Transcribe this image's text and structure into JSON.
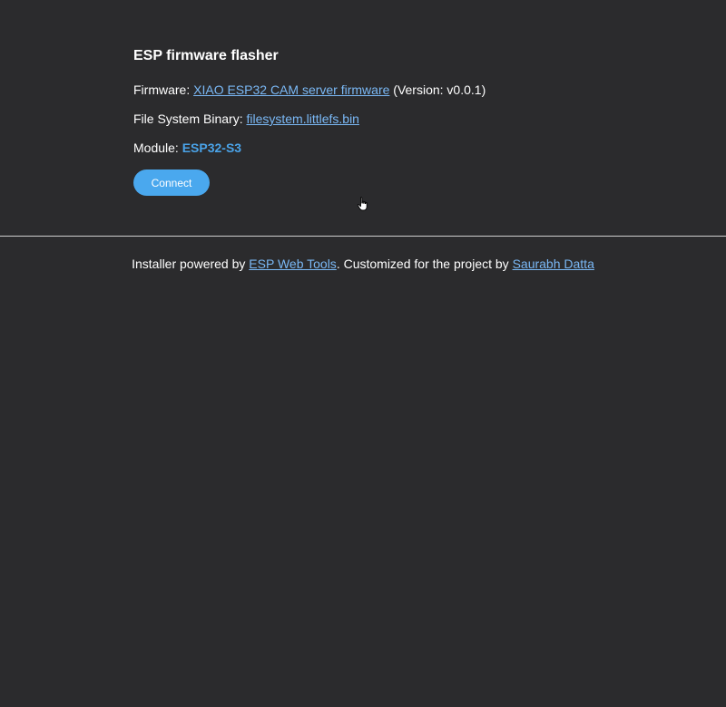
{
  "page": {
    "title": "ESP firmware flasher"
  },
  "firmware": {
    "label": "Firmware:",
    "link_text": "XIAO ESP32 CAM server firmware",
    "version_text": "(Version: v0.0.1)"
  },
  "filesystem": {
    "label": "File System Binary:",
    "link_text": "filesystem.littlefs.bin"
  },
  "module": {
    "label": "Module:",
    "value": "ESP32-S3"
  },
  "actions": {
    "connect_label": "Connect"
  },
  "footer": {
    "prefix": "Installer powered by",
    "tools_link": "ESP Web Tools",
    "middle": ". Customized for the project by",
    "author_link": "Saurabh Datta"
  },
  "colors": {
    "background": "#2b2b2d",
    "link": "#7ab8f5",
    "accent": "#4aa8ee",
    "module_value": "#4aa3e8"
  },
  "icons": {
    "cursor": "hand-pointer-icon"
  }
}
